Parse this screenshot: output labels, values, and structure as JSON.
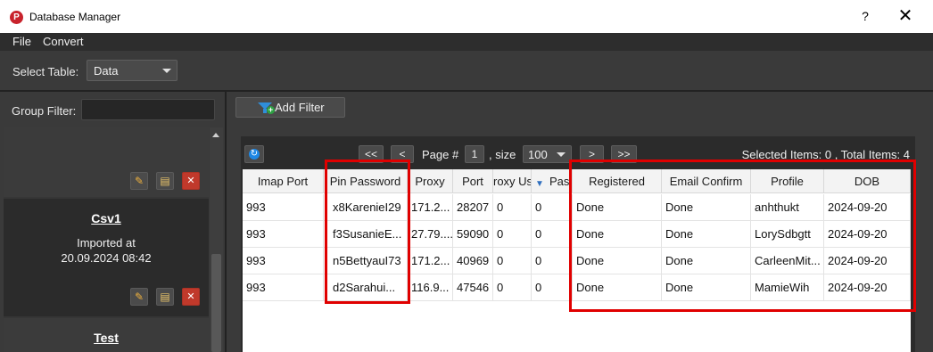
{
  "window": {
    "title": "Database Manager",
    "app_icon": "pinterest-icon",
    "help": "?",
    "close": "✕"
  },
  "menu": {
    "file": "File",
    "convert": "Convert"
  },
  "toolbar": {
    "select_table_label": "Select Table:",
    "select_table_value": "Data"
  },
  "left": {
    "group_filter_label": "Group Filter:",
    "group_filter_value": "",
    "groups": [
      {
        "name": "Csv1",
        "meta_line1": "Imported at",
        "meta_line2": "20.09.2024 08:42"
      },
      {
        "name": "Test"
      }
    ]
  },
  "right": {
    "add_filter_label": "Add Filter",
    "pager": {
      "first": "<<",
      "prev": "<",
      "page_label": "Page #",
      "page": "1",
      "size_label": ", size",
      "size": "100",
      "next": ">",
      "last": ">>"
    },
    "items_info": "Selected Items:  0  ,  Total Items:  4",
    "columns": [
      "Imap Port",
      "Pin Password",
      "Proxy",
      "Port",
      "roxy Us",
      "Pas",
      "Registered",
      "Email Confirm",
      "Profile",
      "DOB"
    ],
    "rows": [
      [
        "993",
        "x8KarenieI29",
        "171.2...",
        "28207",
        "0",
        "0",
        "Done",
        "Done",
        "anhthukt",
        "2024-09-20"
      ],
      [
        "993",
        "f3SusanieE...",
        "27.79....",
        "59090",
        "0",
        "0",
        "Done",
        "Done",
        "LorySdbgtt",
        "2024-09-20"
      ],
      [
        "993",
        "n5BettyauI73",
        "171.2...",
        "40969",
        "0",
        "0",
        "Done",
        "Done",
        "CarleenMit...",
        "2024-09-20"
      ],
      [
        "993",
        "d2Sarahui...",
        "116.9...",
        "47546",
        "0",
        "0",
        "Done",
        "Done",
        "MamieWih",
        "2024-09-20"
      ]
    ]
  },
  "colors": {
    "highlight": "#e00000",
    "accent": "#2f8ed9",
    "delete": "#c0392b"
  }
}
